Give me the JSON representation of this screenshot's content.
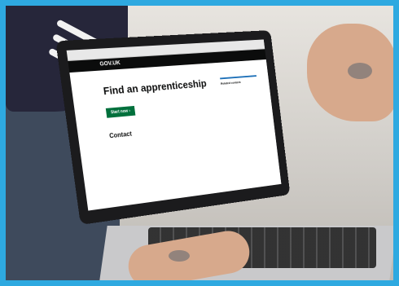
{
  "page": {
    "header_logo": "GOV.UK",
    "title": "Find an apprenticeship",
    "start_button": "Start now",
    "section_contact": "Contact",
    "related_title": "Related content"
  }
}
